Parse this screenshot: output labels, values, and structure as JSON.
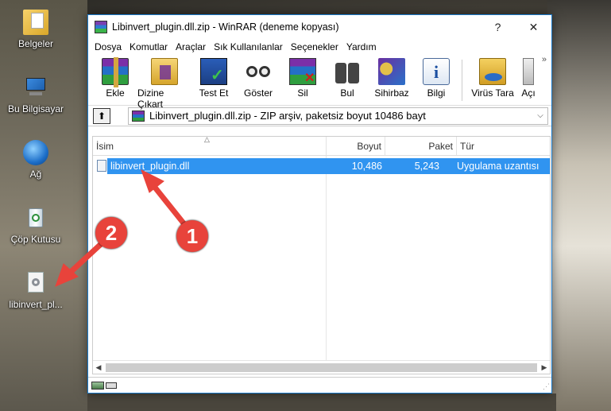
{
  "desktop": {
    "icons": [
      {
        "label": "Belgeler",
        "icon": "documents-folder-icon"
      },
      {
        "label": "Bu Bilgisayar",
        "icon": "computer-icon"
      },
      {
        "label": "Ağ",
        "icon": "network-icon"
      },
      {
        "label": "Çöp Kutusu",
        "icon": "recycle-bin-icon"
      },
      {
        "label": "libinvert_pl...",
        "icon": "dll-file-icon"
      }
    ]
  },
  "window": {
    "title": "Libinvert_plugin.dll.zip - WinRAR (deneme kopyası)",
    "help_label": "?",
    "close_label": "✕",
    "menu": [
      "Dosya",
      "Komutlar",
      "Araçlar",
      "Sık Kullanılanlar",
      "Seçenekler",
      "Yardım"
    ],
    "toolbar": [
      {
        "label": "Ekle",
        "icon": "add-archive-icon"
      },
      {
        "label": "Dizine Çıkart",
        "icon": "extract-to-icon"
      },
      {
        "label": "Test Et",
        "icon": "test-icon"
      },
      {
        "label": "Göster",
        "icon": "view-icon"
      },
      {
        "label": "Sil",
        "icon": "delete-icon"
      },
      {
        "label": "Bul",
        "icon": "find-icon"
      },
      {
        "label": "Sihirbaz",
        "icon": "wizard-icon"
      },
      {
        "label": "Bilgi",
        "icon": "info-icon"
      },
      {
        "label": "Virüs Tara",
        "icon": "virus-scan-icon"
      },
      {
        "label": "Açı",
        "icon": "open-icon"
      }
    ],
    "toolbar_more": "»",
    "address": "Libinvert_plugin.dll.zip - ZIP arşiv, paketsiz boyut 10486 bayt",
    "columns": {
      "name": "İsim",
      "size": "Boyut",
      "packed": "Paket",
      "type": "Tür"
    },
    "rows": [
      {
        "name": "libinvert_plugin.dll",
        "size": "10,486",
        "packed": "5,243",
        "type": "Uygulama uzantısı"
      }
    ]
  },
  "annotations": {
    "step1": "1",
    "step2": "2",
    "arrow_color": "#e8433b"
  }
}
